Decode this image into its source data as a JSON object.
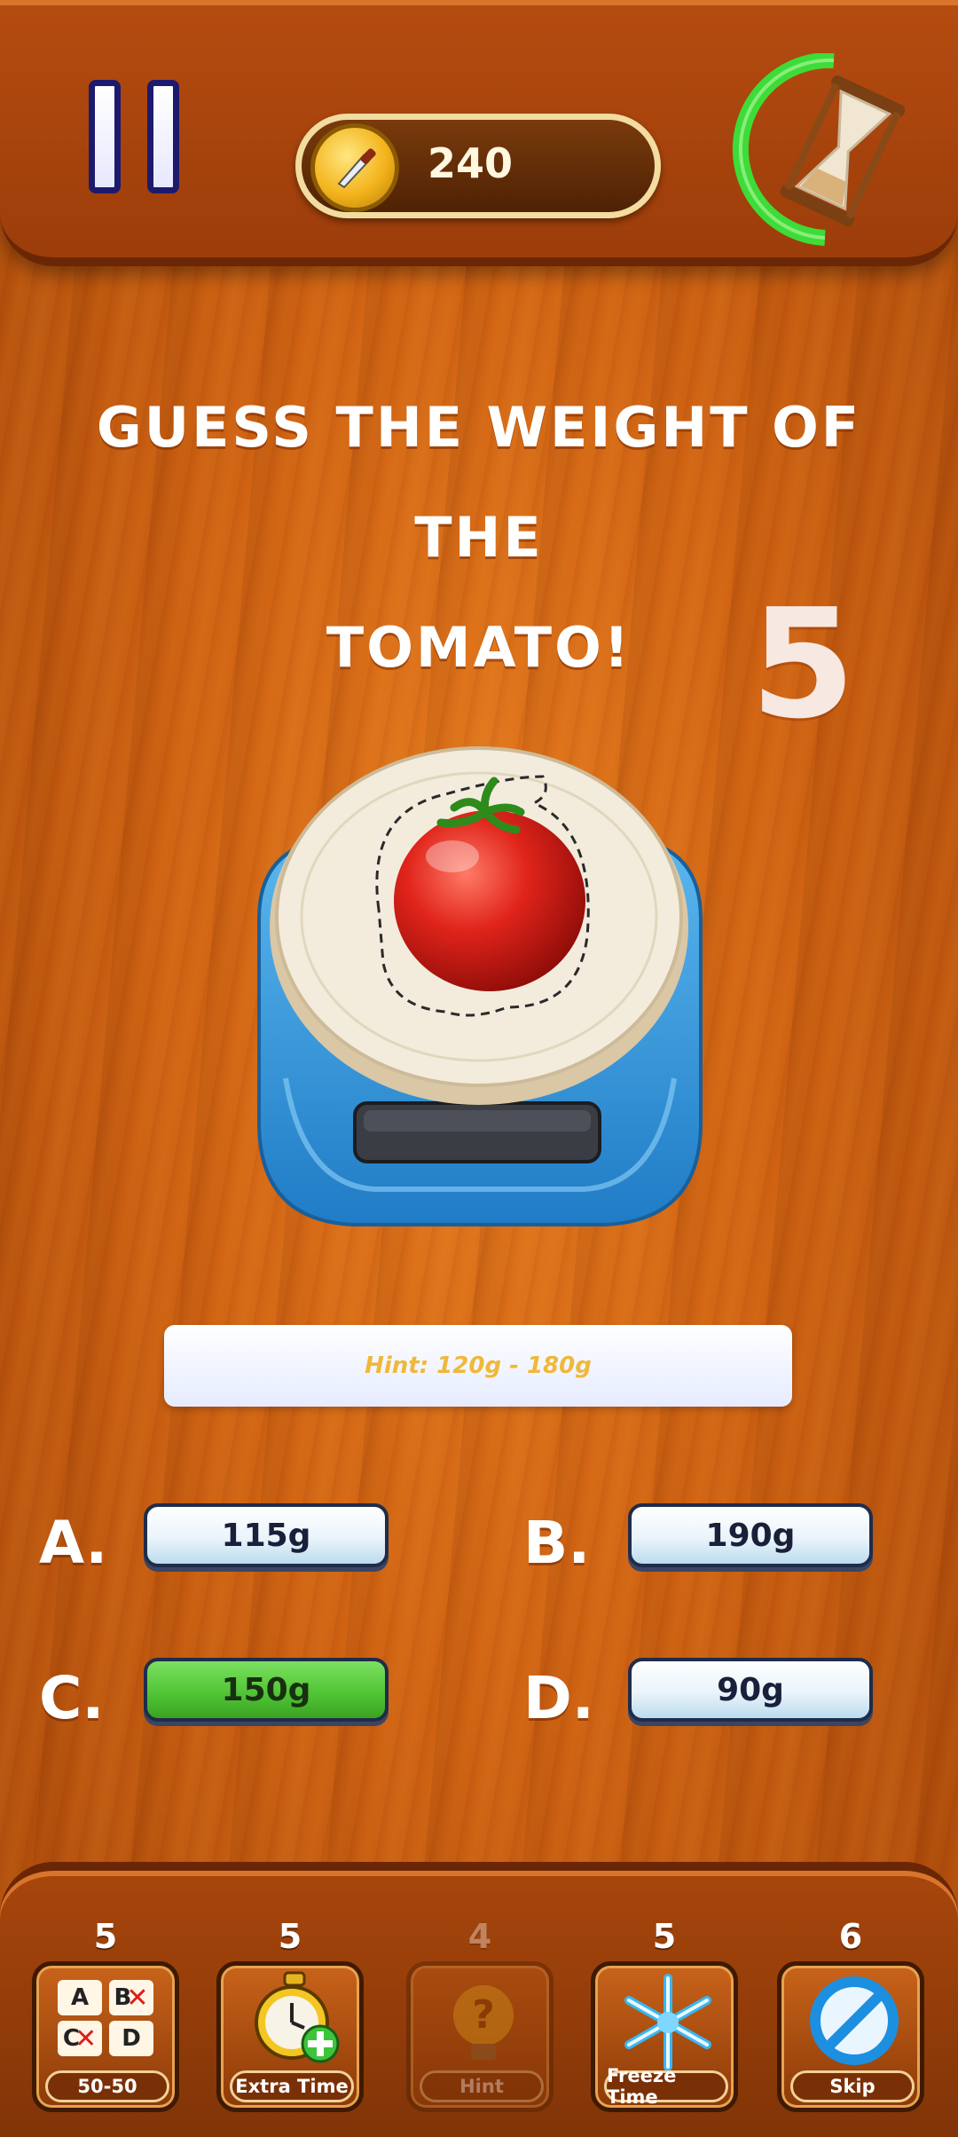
{
  "top": {
    "coins": "240"
  },
  "question": {
    "line1": "GUESS THE WEIGHT OF THE",
    "line2": "TOMATO!"
  },
  "countdown": "5",
  "hint": "Hint: 120g - 180g",
  "answers": [
    {
      "letter": "A.",
      "value": "115g",
      "selected": false
    },
    {
      "letter": "B.",
      "value": "190g",
      "selected": false
    },
    {
      "letter": "C.",
      "value": "150g",
      "selected": true
    },
    {
      "letter": "D.",
      "value": "90g",
      "selected": false
    }
  ],
  "powerups": [
    {
      "count": "5",
      "label": "50-50",
      "icon": "fifty-fifty-icon",
      "enabled": true,
      "grid": [
        "A",
        "B",
        "C",
        "D"
      ]
    },
    {
      "count": "5",
      "label": "Extra Time",
      "icon": "stopwatch-plus-icon",
      "enabled": true
    },
    {
      "count": "4",
      "label": "Hint",
      "icon": "lightbulb-question-icon",
      "enabled": false
    },
    {
      "count": "5",
      "label": "Freeze Time",
      "icon": "snowflake-icon",
      "enabled": true
    },
    {
      "count": "6",
      "label": "Skip",
      "icon": "skip-icon",
      "enabled": true
    }
  ],
  "colors": {
    "selected_answer": "#4fc233",
    "timer_ring": "#3ddc38",
    "hint_text": "#f0b83a"
  }
}
